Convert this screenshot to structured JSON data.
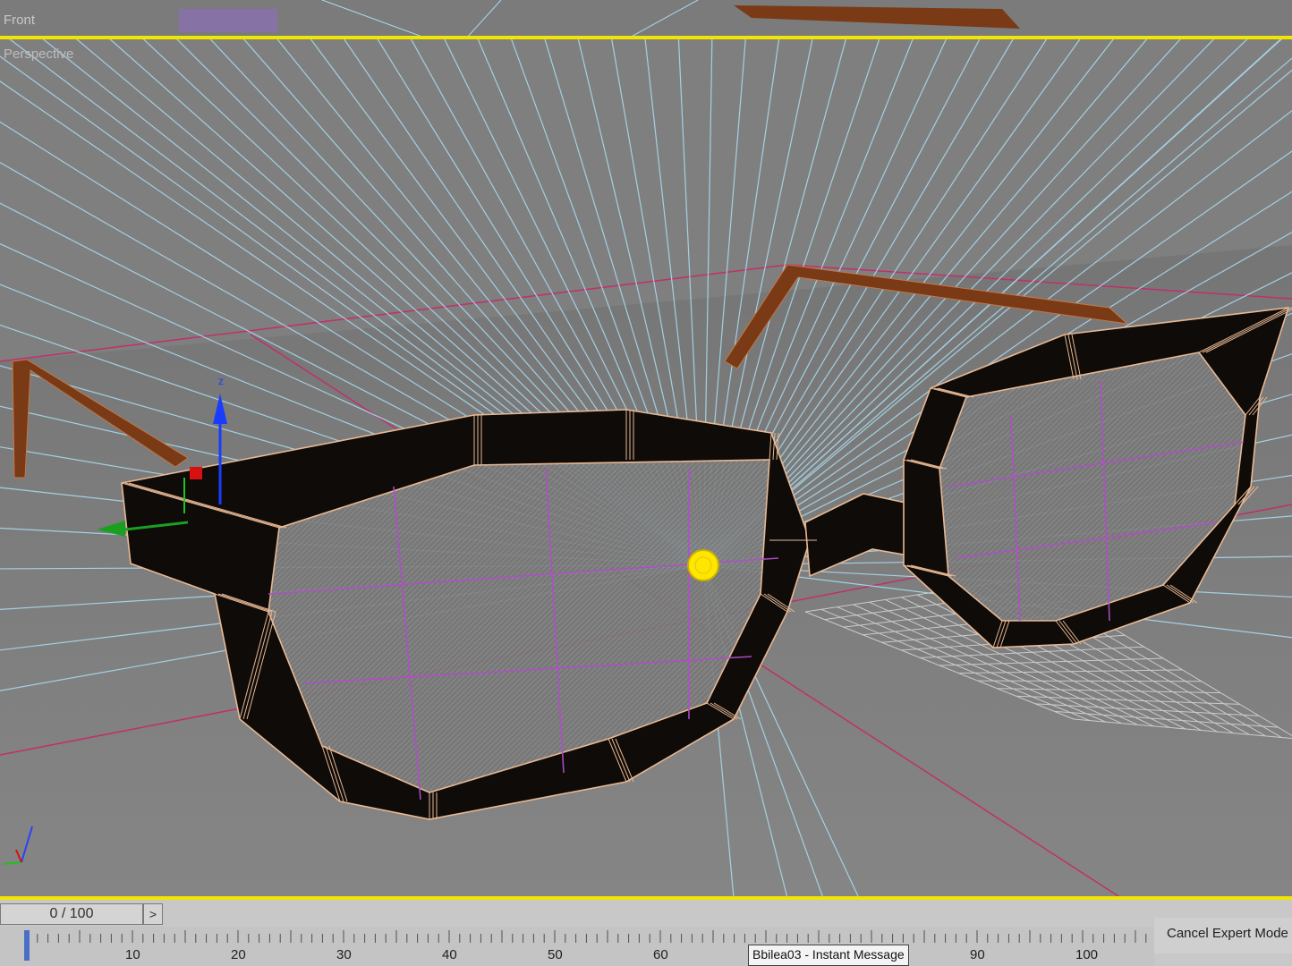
{
  "viewports": {
    "front_label": "Front",
    "perspective_label": "Perspective"
  },
  "timeline": {
    "frame_display": "0 / 100",
    "next_button": ">",
    "ruler_ticks": [
      "10",
      "20",
      "30",
      "40",
      "50",
      "60",
      "90",
      "100"
    ]
  },
  "status": {
    "cancel_expert_mode": "Cancel Expert Mode"
  },
  "taskbar_tooltip": "Bbilea03 - Instant Message",
  "colors": {
    "active_border": "#f2e600",
    "frame": "#0e0b09",
    "frame_edges": "#e8b892",
    "temple": "#7a3a16",
    "light_rays": "#a9d9ee",
    "selection_lines": "#b04ec8",
    "ground_plane": "#c0306a",
    "light_source": "#ffe600"
  },
  "icons": {
    "axis_gizmo": "xyz-axis-icon",
    "light": "omni-light-icon"
  }
}
